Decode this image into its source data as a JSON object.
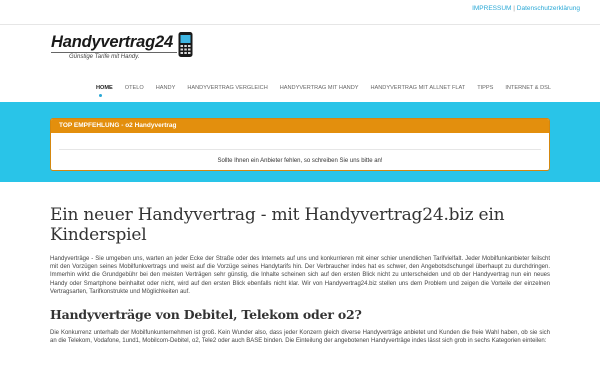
{
  "topbar": {
    "impressum": "IMPRESSUM",
    "separator": "|",
    "datenschutz": "Datenschutzerklärung"
  },
  "logo": {
    "brand": "Handyvertrag",
    "number": "24",
    "tagline": "Günstige Tarife mit Handy."
  },
  "nav": {
    "items": [
      {
        "label": "HOME"
      },
      {
        "label": "OTELO"
      },
      {
        "label": "HANDY"
      },
      {
        "label": "HANDYVERTRAG VERGLEICH"
      },
      {
        "label": "HANDYVERTRAG MIT HANDY"
      },
      {
        "label": "HANDYVERTRAG MIT ALLNET FLAT"
      },
      {
        "label": "TIPPS"
      },
      {
        "label": "INTERNET & DSL"
      }
    ]
  },
  "recommendation": {
    "title": "TOP EMPFEHLUNG - o2 Handyvertrag",
    "message": "Sollte Ihnen ein Anbieter fehlen, so schreiben Sie uns bitte an!"
  },
  "article": {
    "heading": "Ein neuer Handyvertrag - mit Handyvertrag24.biz ein Kinderspiel",
    "intro": "Handyverträge - Sie umgeben uns, warten an jeder Ecke der Straße oder des Internets auf uns und konkurrieren mit einer schier unendlichen Tarifvielfalt. Jeder Mobilfunkanbieter feilscht mit den Vorzügen seines Mobilfunkvertrags und weist auf die Vorzüge seines Handytarifs hin. Der Verbraucher indes hat es schwer, den Angebotsdschungel überhaupt zu durchdringen. Immerhin wirkt die Grundgebühr bei den meisten Verträgen sehr günstig, die Inhalte scheinen sich auf den ersten Blick nicht zu unterscheiden und ob der Handyvertrag nun ein neues Handy oder Smartphone beinhaltet oder nicht, wird auf den ersten Blick ebenfalls nicht klar. Wir von Handyvertrag24.biz stellen uns dem Problem und zeigen die Vorteile der einzelnen Vertragsarten, Tarifkonstrukte und Möglichkeiten auf.",
    "subheading": "Handyverträge von Debitel, Telekom oder o2?",
    "body": "Die Konkurrenz unterhalb der Mobilfunkunternehmen ist groß. Kein Wunder also, dass jeder Konzern gleich diverse Handyverträge anbietet und Kunden die freie Wahl haben, ob sie sich an die Telekom, Vodafone, 1und1, Mobilcom-Debitel, o2, Tele2 oder auch BASE binden. Die Einteilung der angebotenen Handyverträge indes lässt sich grob in sechs Kategorien einteilen:"
  },
  "colors": {
    "accent": "#2aa8d6",
    "banner": "#29c4e8",
    "recommendation_header": "#e38f0d"
  }
}
